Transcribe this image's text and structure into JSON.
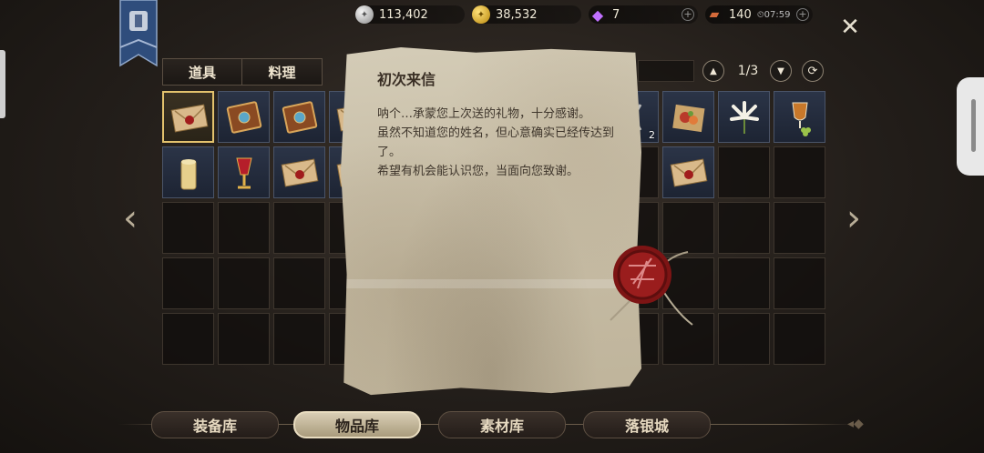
{
  "resources": {
    "silver": {
      "value": "113,402",
      "icon": "silver-coin-icon"
    },
    "gold": {
      "value": "38,532",
      "icon": "gold-coin-icon"
    },
    "gems": {
      "value": "7",
      "icon": "diamond-icon"
    },
    "stamina": {
      "value": "140",
      "timer": "07:59",
      "icon": "ticket-icon"
    }
  },
  "tabs": [
    {
      "label": "道具"
    },
    {
      "label": "料理"
    }
  ],
  "pager": {
    "text": "1/3"
  },
  "grid": {
    "rows": [
      [
        "letter",
        "book",
        "book",
        "letter",
        "",
        "",
        "",
        "",
        "tool",
        "food",
        "lily",
        "wine"
      ],
      [
        "candle",
        "goblet",
        "letter",
        "letter",
        "",
        "",
        "",
        "",
        "",
        "letter",
        "",
        ""
      ],
      [
        "",
        "",
        "",
        "",
        "",
        "",
        "",
        "",
        "",
        "",
        "",
        ""
      ],
      [
        "",
        "",
        "",
        "",
        "",
        "",
        "",
        "",
        "",
        "",
        "",
        ""
      ],
      [
        "",
        "",
        "",
        "",
        "",
        "",
        "",
        "",
        "",
        "",
        "",
        ""
      ]
    ],
    "quantity_badge": "2"
  },
  "letter": {
    "title": "初次来信",
    "lines": [
      "呐个…承蒙您上次送的礼物，十分感谢。",
      "虽然不知道您的姓名，但心意确实已经传达到了。",
      "希望有机会能认识您，当面向您致谢。"
    ]
  },
  "bottom_nav": [
    {
      "label": "装备库"
    },
    {
      "label": "物品库",
      "active": true
    },
    {
      "label": "素材库"
    },
    {
      "label": "落银城"
    }
  ],
  "colors": {
    "accent": "#e3c26d",
    "seal": "#8b1a1a",
    "paper": "#c8bea7"
  }
}
